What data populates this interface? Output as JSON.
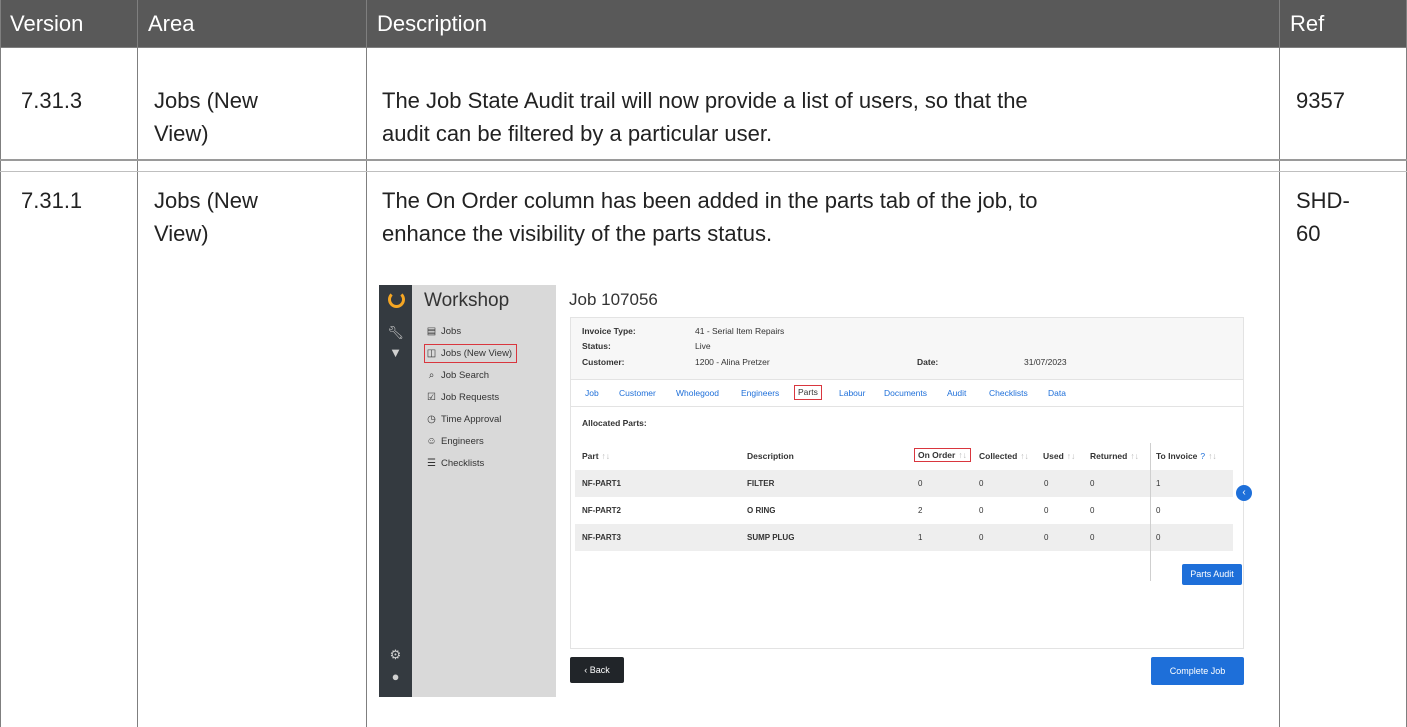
{
  "table": {
    "headers": [
      "Version",
      "Area",
      "Description",
      "Ref"
    ],
    "rows": [
      {
        "version": "7.31.3",
        "area_line1": "Jobs (New",
        "area_line2": "View)",
        "desc_line1": "The Job State Audit trail will now provide a list of users, so that the",
        "desc_line2": "audit can be filtered by a particular user.",
        "ref": "9357"
      },
      {
        "version": "7.31.1",
        "area_line1": "Jobs (New",
        "area_line2": "View)",
        "desc_line1": "The On Order column has been added in the parts tab of the job, to",
        "desc_line2": "enhance the visibility of the parts status.",
        "ref_line1": "SHD-",
        "ref_line2": "60"
      }
    ]
  },
  "screenshot": {
    "app_title": "Workshop",
    "nav_items": [
      {
        "label": "Jobs",
        "icon": "clipboard-icon"
      },
      {
        "label": "Jobs (New View)",
        "icon": "columns-icon"
      },
      {
        "label": "Job Search",
        "icon": "search-icon"
      },
      {
        "label": "Job Requests",
        "icon": "clipboard-check-icon"
      },
      {
        "label": "Time Approval",
        "icon": "clock-icon"
      },
      {
        "label": "Engineers",
        "icon": "users-icon"
      },
      {
        "label": "Checklists",
        "icon": "list-check-icon"
      }
    ],
    "job_title": "Job 107056",
    "info": {
      "invoice_type_label": "Invoice Type:",
      "invoice_type_value": "41 - Serial Item Repairs",
      "status_label": "Status:",
      "status_value": "Live",
      "customer_label": "Customer:",
      "customer_value": "1200 - Alina Pretzer",
      "date_label": "Date:",
      "date_value": "31/07/2023"
    },
    "tabs": [
      "Job",
      "Customer",
      "Wholegood",
      "Engineers",
      "Parts",
      "Labour",
      "Documents",
      "Audit",
      "Checklists",
      "Data"
    ],
    "selected_tab": "Parts",
    "allocated_label": "Allocated Parts:",
    "columns": [
      "Part",
      "Description",
      "On Order",
      "Collected",
      "Used",
      "Returned",
      "To Invoice"
    ],
    "sort_glyph": "↑↓",
    "help_glyph": "?",
    "parts": [
      {
        "part": "NF-PART1",
        "description": "FILTER",
        "on_order": "0",
        "collected": "0",
        "used": "0",
        "returned": "0",
        "to_invoice": "1"
      },
      {
        "part": "NF-PART2",
        "description": "O RING",
        "on_order": "2",
        "collected": "0",
        "used": "0",
        "returned": "0",
        "to_invoice": "0"
      },
      {
        "part": "NF-PART3",
        "description": "SUMP PLUG",
        "on_order": "1",
        "collected": "0",
        "used": "0",
        "returned": "0",
        "to_invoice": "0"
      }
    ],
    "parts_audit_button": "Parts Audit",
    "back_button": "Back",
    "complete_button": "Complete Job",
    "colors": {
      "accent": "#1e6fd9",
      "highlight": "#d9363e",
      "logo": "#f5a623",
      "rail": "#343a40",
      "header": "#595959"
    }
  }
}
